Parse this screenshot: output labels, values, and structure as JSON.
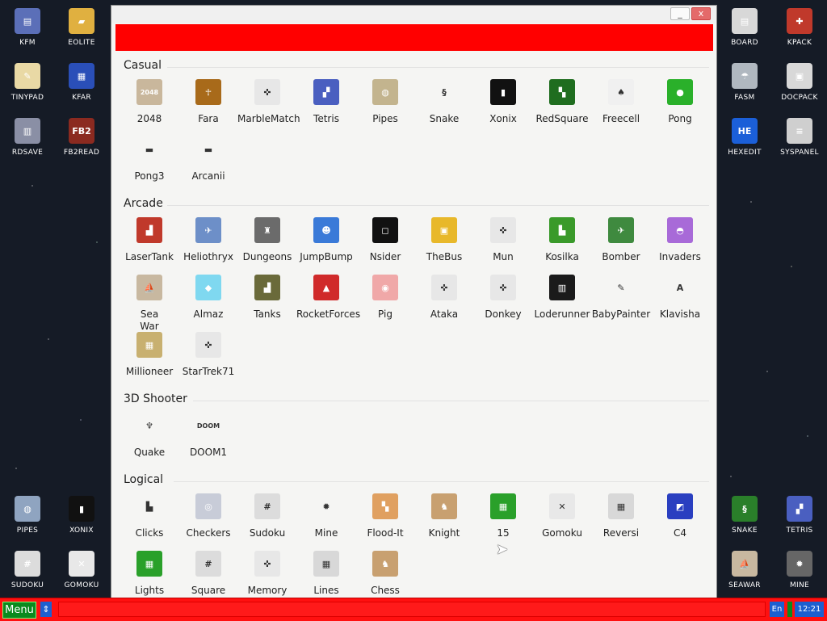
{
  "desktop": {
    "left_icons": [
      {
        "label": "KFM",
        "icon": "floppy-icon",
        "color": "#5b6fb8",
        "glyph": "▤"
      },
      {
        "label": "EOLITE",
        "icon": "folder-icon",
        "color": "#e0b040",
        "glyph": "▰"
      },
      {
        "label": "TINYPAD",
        "icon": "notepad-icon",
        "color": "#e9d9a5",
        "glyph": "✎"
      },
      {
        "label": "KFAR",
        "icon": "kfar-icon",
        "color": "#2a4fb8",
        "glyph": "▦"
      },
      {
        "label": "RDSAVE",
        "icon": "rdsave-icon",
        "color": "#8a8fa5",
        "glyph": "▥"
      },
      {
        "label": "FB2READ",
        "icon": "book-icon",
        "color": "#8b2a20",
        "glyph": "FB2"
      },
      {
        "label": "PIPES",
        "icon": "pipes-icon",
        "color": "#8fa4c0",
        "glyph": "◍"
      },
      {
        "label": "XONIX",
        "icon": "xonix-icon",
        "color": "#111111",
        "glyph": "▮"
      },
      {
        "label": "SUDOKU",
        "icon": "sudoku-icon",
        "color": "#dcdcdc",
        "glyph": "#"
      },
      {
        "label": "GOMOKU",
        "icon": "gomoku-icon",
        "color": "#e8e8e8",
        "glyph": "✕"
      }
    ],
    "right_icons": [
      {
        "label": "BOARD",
        "icon": "board-icon",
        "color": "#d8d8d8",
        "glyph": "▤"
      },
      {
        "label": "KPACK",
        "icon": "wrench-icon",
        "color": "#c0392b",
        "glyph": "✚"
      },
      {
        "label": "FASM",
        "icon": "fasm-icon",
        "color": "#b0b8c0",
        "glyph": "☂"
      },
      {
        "label": "DOCPACK",
        "icon": "docpack-icon",
        "color": "#d8d8d8",
        "glyph": "▣"
      },
      {
        "label": "HEXEDIT",
        "icon": "hexedit-icon",
        "color": "#1b5fd8",
        "glyph": "HE"
      },
      {
        "label": "SYSPANEL",
        "icon": "syspanel-icon",
        "color": "#cfcfcf",
        "glyph": "≡"
      },
      {
        "label": "SNAKE",
        "icon": "snake-icon",
        "color": "#2a7f2a",
        "glyph": "§"
      },
      {
        "label": "TETRIS",
        "icon": "tetris-icon",
        "color": "#4a5fc0",
        "glyph": "▞"
      },
      {
        "label": "SEAWAR",
        "icon": "ship-icon",
        "color": "#c8b8a0",
        "glyph": "⛵"
      },
      {
        "label": "MINE",
        "icon": "mine-icon",
        "color": "#666666",
        "glyph": "✹"
      }
    ]
  },
  "window": {
    "minimize_label": "_",
    "close_label": "x",
    "sections": [
      {
        "title": "Casual",
        "apps": [
          {
            "label": "2048",
            "icon": "2048-icon",
            "color": "#c9b79c",
            "glyph": "2048"
          },
          {
            "label": "Fara",
            "icon": "fara-icon",
            "color": "#a86a1a",
            "glyph": "☥"
          },
          {
            "label": "MarbleMatch",
            "icon": "gamepad-icon",
            "color": "#e7e7e7",
            "glyph": "✜"
          },
          {
            "label": "Tetris",
            "icon": "tetris-icon",
            "color": "#4a5fc0",
            "glyph": "▞"
          },
          {
            "label": "Pipes",
            "icon": "pipes-icon",
            "color": "#c3b48e",
            "glyph": "◍"
          },
          {
            "label": "Snake",
            "icon": "snake-icon",
            "color": "#f5f5f3",
            "glyph": "§"
          },
          {
            "label": "Xonix",
            "icon": "xonix-icon",
            "color": "#111111",
            "glyph": "▮"
          },
          {
            "label": "RedSquare",
            "icon": "redsquare-icon",
            "color": "#1f6d1f",
            "glyph": "▚"
          },
          {
            "label": "Freecell",
            "icon": "cards-icon",
            "color": "#f0f0f0",
            "glyph": "♠"
          },
          {
            "label": "Pong",
            "icon": "pong-icon",
            "color": "#2ab02a",
            "glyph": "●"
          },
          {
            "label": "Pong3",
            "icon": "pong3-icon",
            "color": "#f5f5f3",
            "glyph": "▬"
          },
          {
            "label": "Arcanii",
            "icon": "arcanii-icon",
            "color": "#f5f5f3",
            "glyph": "▬"
          }
        ]
      },
      {
        "title": "Arcade",
        "apps": [
          {
            "label": "LaserTank",
            "icon": "tank-red-icon",
            "color": "#c0392b",
            "glyph": "▟"
          },
          {
            "label": "Heliothryx",
            "icon": "plane-icon",
            "color": "#6d8fc8",
            "glyph": "✈"
          },
          {
            "label": "Dungeons",
            "icon": "castle-icon",
            "color": "#6b6b6b",
            "glyph": "♜"
          },
          {
            "label": "JumpBump",
            "icon": "jumpbump-icon",
            "color": "#3a7ad8",
            "glyph": "☻"
          },
          {
            "label": "Nsider",
            "icon": "nsider-icon",
            "color": "#111111",
            "glyph": "◻"
          },
          {
            "label": "TheBus",
            "icon": "bus-icon",
            "color": "#e8b82a",
            "glyph": "▣"
          },
          {
            "label": "Mun",
            "icon": "gamepad-icon",
            "color": "#e7e7e7",
            "glyph": "✜"
          },
          {
            "label": "Kosilka",
            "icon": "mower-icon",
            "color": "#3a9a2a",
            "glyph": "▙"
          },
          {
            "label": "Bomber",
            "icon": "bomber-icon",
            "color": "#3f8a3f",
            "glyph": "✈"
          },
          {
            "label": "Invaders",
            "icon": "ufo-icon",
            "color": "#a86ad8",
            "glyph": "◓"
          },
          {
            "label": "Sea\nWar",
            "icon": "ship-icon",
            "color": "#c8b8a0",
            "glyph": "⛵"
          },
          {
            "label": "Almaz",
            "icon": "diamond-icon",
            "color": "#7fd8f0",
            "glyph": "◆"
          },
          {
            "label": "Tanks",
            "icon": "tank-icon",
            "color": "#6a6a3a",
            "glyph": "▟"
          },
          {
            "label": "RocketForces",
            "icon": "rocket-icon",
            "color": "#d02a2a",
            "glyph": "▲"
          },
          {
            "label": "Pig",
            "icon": "pig-icon",
            "color": "#f0a8a8",
            "glyph": "◉"
          },
          {
            "label": "Ataka",
            "icon": "gamepad-icon",
            "color": "#e7e7e7",
            "glyph": "✜"
          },
          {
            "label": "Donkey",
            "icon": "gamepad-icon",
            "color": "#e7e7e7",
            "glyph": "✜"
          },
          {
            "label": "Loderunner",
            "icon": "loderunner-icon",
            "color": "#1a1a1a",
            "glyph": "▥"
          },
          {
            "label": "BabyPainter",
            "icon": "paintbrush-icon",
            "color": "#f5f5f3",
            "glyph": "✎"
          },
          {
            "label": "Klavisha",
            "icon": "key-icon",
            "color": "#f5f5f3",
            "glyph": "A"
          },
          {
            "label": "Millioneer",
            "icon": "map-icon",
            "color": "#c8b070",
            "glyph": "▦"
          },
          {
            "label": "StarTrek71",
            "icon": "gamepad-icon",
            "color": "#e7e7e7",
            "glyph": "✜"
          }
        ]
      },
      {
        "title": "3D Shooter",
        "apps": [
          {
            "label": "Quake",
            "icon": "quake-icon",
            "color": "#f5f5f3",
            "glyph": "♆"
          },
          {
            "label": "DOOM1",
            "icon": "doom-icon",
            "color": "#f5f5f3",
            "glyph": "DOOM"
          }
        ]
      },
      {
        "title": "Logical",
        "apps": [
          {
            "label": "Clicks",
            "icon": "clicks-icon",
            "color": "#f5f5f3",
            "glyph": "▙"
          },
          {
            "label": "Checkers",
            "icon": "checkers-icon",
            "color": "#c8ccd8",
            "glyph": "◎"
          },
          {
            "label": "Sudoku",
            "icon": "sudoku-icon",
            "color": "#dcdcdc",
            "glyph": "#"
          },
          {
            "label": "Mine",
            "icon": "mine-icon",
            "color": "#f5f5f3",
            "glyph": "✹"
          },
          {
            "label": "Flood-It",
            "icon": "floodit-icon",
            "color": "#e0a060",
            "glyph": "▚"
          },
          {
            "label": "Knight",
            "icon": "knight-icon",
            "color": "#c8a070",
            "glyph": "♞"
          },
          {
            "label": "15",
            "icon": "fifteen-icon",
            "color": "#2aa02a",
            "glyph": "▦"
          },
          {
            "label": "Gomoku",
            "icon": "gomoku-icon",
            "color": "#e8e8e8",
            "glyph": "✕"
          },
          {
            "label": "Reversi",
            "icon": "reversi-icon",
            "color": "#d8d8d8",
            "glyph": "▦"
          },
          {
            "label": "C4",
            "icon": "c4-icon",
            "color": "#2a3fc0",
            "glyph": "◩"
          },
          {
            "label": "Lights",
            "icon": "lights-icon",
            "color": "#2aa02a",
            "glyph": "▦"
          },
          {
            "label": "Square",
            "icon": "square-icon",
            "color": "#dcdcdc",
            "glyph": "#"
          },
          {
            "label": "Memory",
            "icon": "gamepad-icon",
            "color": "#e7e7e7",
            "glyph": "✜"
          },
          {
            "label": "Lines",
            "icon": "lines-icon",
            "color": "#d8d8d8",
            "glyph": "▦"
          },
          {
            "label": "Chess",
            "icon": "chess-icon",
            "color": "#c8a070",
            "glyph": "♞"
          }
        ]
      }
    ]
  },
  "taskbar": {
    "menu_label": "Menu",
    "arrow_label": "⇕",
    "lang_label": "En",
    "clock": "12:21"
  }
}
